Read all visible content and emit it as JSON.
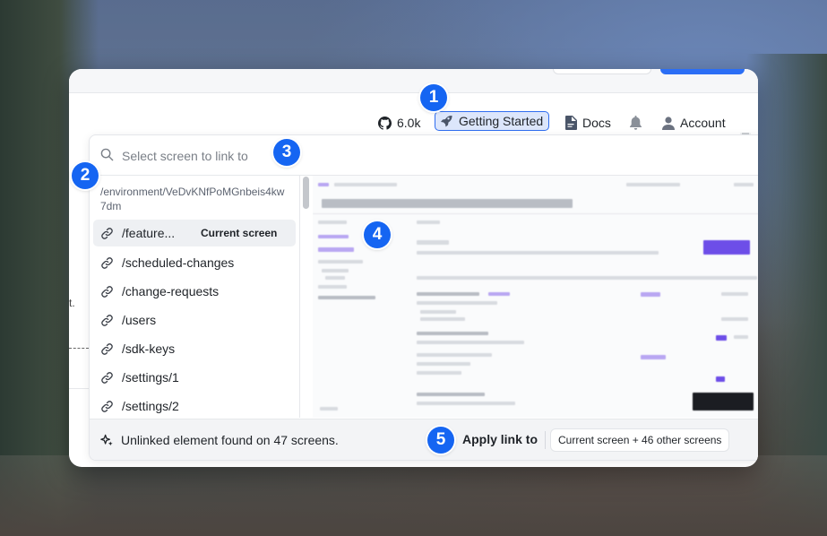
{
  "navbar": {
    "github_stars": "6.0k",
    "getting_started": "Getting Started",
    "docs": "Docs",
    "account": "Account"
  },
  "search": {
    "placeholder": "Select screen to link to"
  },
  "screen_list": {
    "current_path": "/environment/VeDvKNfPoMGnbeis4kw7dm",
    "current_tag": "Current screen",
    "items": [
      {
        "label": "/feature..."
      },
      {
        "label": "/scheduled-changes"
      },
      {
        "label": "/change-requests"
      },
      {
        "label": "/users"
      },
      {
        "label": "/sdk-keys"
      },
      {
        "label": "/settings/1"
      },
      {
        "label": "/settings/2"
      }
    ]
  },
  "footer": {
    "message": "Unlinked element found on 47 screens.",
    "apply_label": "Apply link to",
    "scope": "Current screen + 46 other screens"
  },
  "page_fragments": {
    "left_text": "t."
  },
  "markers": [
    "1",
    "2",
    "3",
    "4",
    "5"
  ],
  "colors": {
    "accent": "#1565f2",
    "highlight_bg": "#dce6fb",
    "highlight_border": "#2f6df0"
  }
}
